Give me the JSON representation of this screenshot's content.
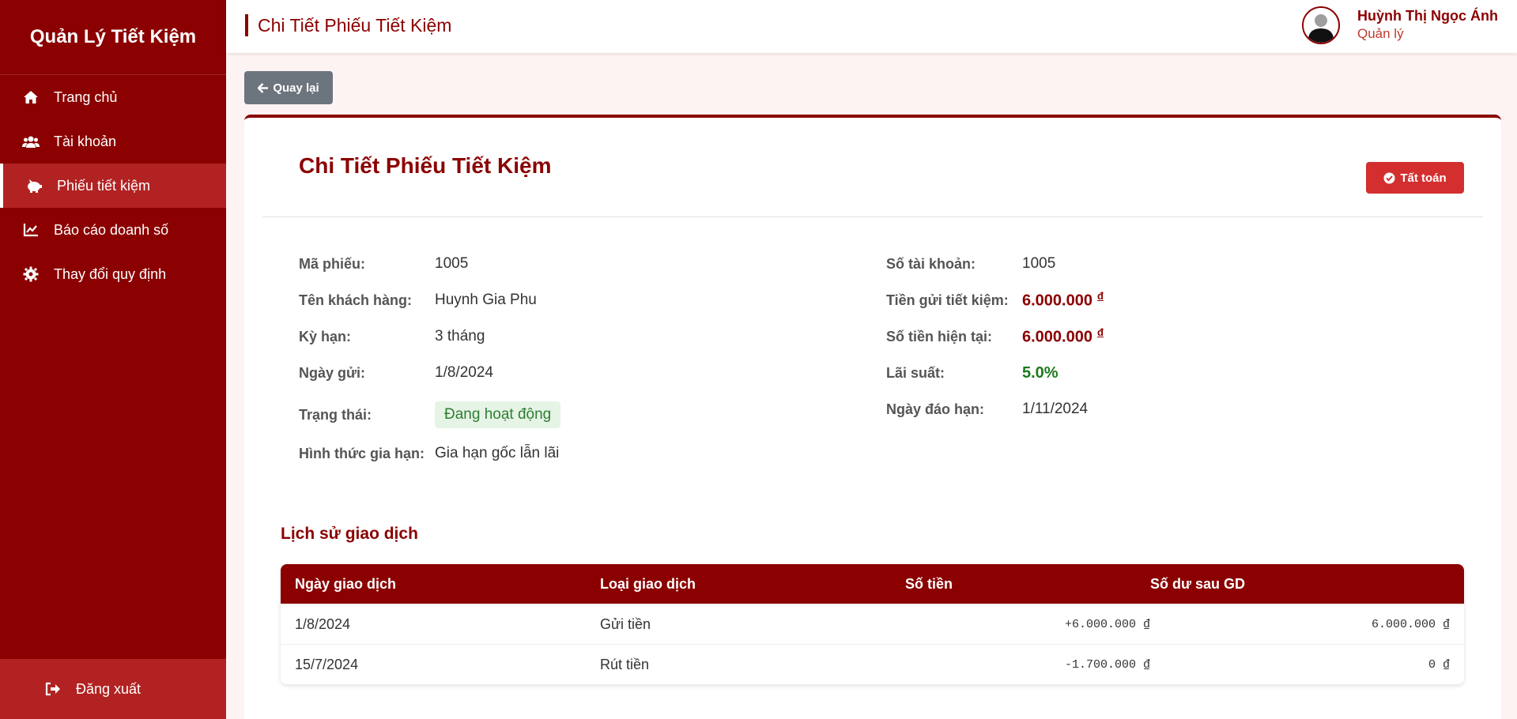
{
  "sidebar": {
    "brand": "Quản Lý Tiết Kiệm",
    "items": [
      {
        "label": "Trang chủ",
        "icon": "home-icon"
      },
      {
        "label": "Tài khoản",
        "icon": "users-icon"
      },
      {
        "label": "Phiếu tiết kiệm",
        "icon": "piggy-bank-icon",
        "active": true
      },
      {
        "label": "Báo cáo doanh số",
        "icon": "chart-line-icon"
      },
      {
        "label": "Thay đổi quy định",
        "icon": "gear-icon"
      }
    ],
    "logout": "Đăng xuất"
  },
  "header": {
    "title": "Chi Tiết Phiếu Tiết Kiệm",
    "user_name": "Huỳnh Thị Ngọc Ánh",
    "user_role": "Quản lý"
  },
  "back_label": "Quay lại",
  "card": {
    "title": "Chi Tiết Phiếu Tiết Kiệm",
    "settle_label": "Tất toán"
  },
  "details_left": [
    {
      "label": "Mã phiếu:",
      "value": "1005"
    },
    {
      "label": "Tên khách hàng:",
      "value": "Huynh Gia Phu"
    },
    {
      "label": "Kỳ hạn:",
      "value": "3 tháng"
    },
    {
      "label": "Ngày gửi:",
      "value": "1/8/2024"
    },
    {
      "label": "Trạng thái:",
      "value": "Đang hoạt động"
    },
    {
      "label": "Hình thức gia hạn:",
      "value": "Gia hạn gốc lẫn lãi"
    }
  ],
  "details_right": [
    {
      "label": "Số tài khoản:",
      "value": "1005"
    },
    {
      "label": "Tiền gửi tiết kiệm:",
      "value": "6.000.000",
      "currency": "đ"
    },
    {
      "label": "Số tiền hiện tại:",
      "value": "6.000.000",
      "currency": "đ"
    },
    {
      "label": "Lãi suất:",
      "value": "5.0%"
    },
    {
      "label": "Ngày đáo hạn:",
      "value": "1/11/2024"
    }
  ],
  "history": {
    "title": "Lịch sử giao dịch",
    "columns": [
      "Ngày giao dịch",
      "Loại giao dịch",
      "Số tiền",
      "Số dư sau GD"
    ],
    "rows": [
      [
        "1/8/2024",
        "Gửi tiền",
        "+6.000.000 ₫",
        "6.000.000 ₫"
      ],
      [
        "15/7/2024",
        "Rút tiền",
        "-1.700.000 ₫",
        "0 ₫"
      ]
    ]
  },
  "colors": {
    "brand": "#8b0000",
    "active": "#b22222",
    "danger": "#d32f2f",
    "success": "#2e7d32"
  }
}
